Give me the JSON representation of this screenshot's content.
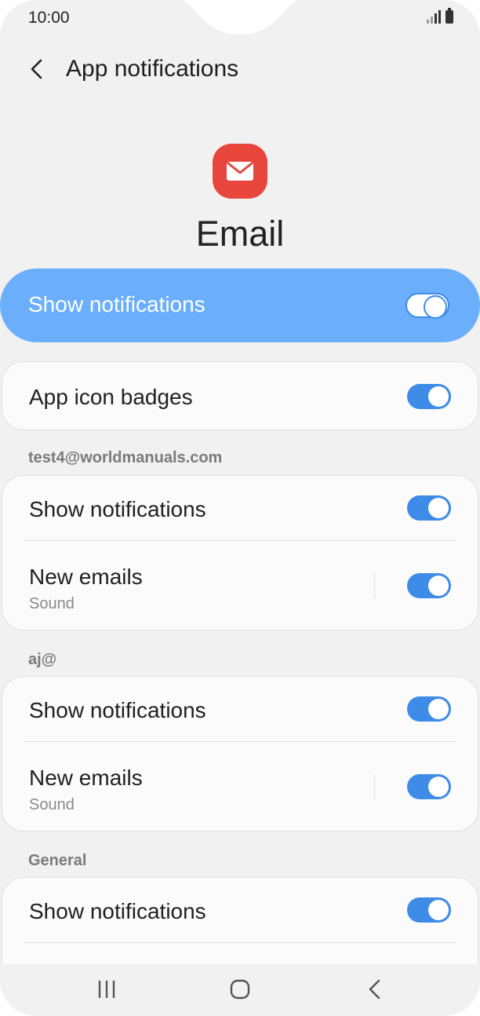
{
  "status_bar": {
    "time": "10:00"
  },
  "header": {
    "title": "App notifications"
  },
  "app": {
    "name": "Email"
  },
  "master": {
    "label": "Show notifications",
    "enabled": true
  },
  "badges": {
    "label": "App icon badges",
    "enabled": true
  },
  "accounts": [
    {
      "header": "test4@worldmanuals.com",
      "rows": [
        {
          "label": "Show notifications",
          "enabled": true
        },
        {
          "label": "New emails",
          "sub": "Sound",
          "enabled": true
        }
      ]
    },
    {
      "header": "aj@",
      "rows": [
        {
          "label": "Show notifications",
          "enabled": true
        },
        {
          "label": "New emails",
          "sub": "Sound",
          "enabled": true
        }
      ]
    }
  ],
  "general": {
    "header": "General",
    "rows": [
      {
        "label": "Show notifications",
        "enabled": true
      }
    ]
  },
  "icons": [
    "signal-icon",
    "battery-icon",
    "back-arrow-icon",
    "email-app-icon",
    "recent-apps-icon",
    "home-icon",
    "nav-back-icon"
  ],
  "colors": {
    "accent": "#3e8be8",
    "master_bg": "#6aaefc",
    "app_icon": "#e8453c"
  }
}
